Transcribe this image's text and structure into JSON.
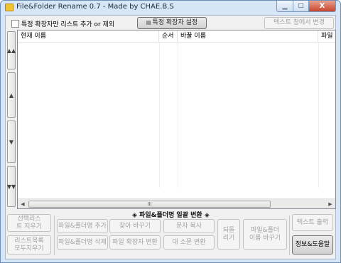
{
  "window": {
    "title": "File&Folder Rename 0.7 - Made by CHAE.B.S",
    "close_glyph": "X"
  },
  "toolbar": {
    "ext_only_label": "특정 확장자만 리스트 추가 or 제외",
    "ext_setting_label": "특정 확장자 설정",
    "text_change_label": "텍스트 창에서 변경"
  },
  "grid": {
    "columns": [
      "현재 이름",
      "순서",
      "바꿀 이름",
      "파일"
    ],
    "scroll_thumb": "III"
  },
  "side_arrows": {
    "top_all": "▲▲",
    "up": "▲",
    "down": "▼",
    "bottom_all": "▼▼"
  },
  "bottom": {
    "group_label": "◈ 파일&폴더명 일괄 변환 ◈",
    "clear_selected": "선택리스트 지우기",
    "clear_all": "리스트목록 모두지우기",
    "add_name": "파일&폴더명 추가",
    "delete_name": "파일&폴더명 삭제",
    "find_replace": "찾아 바꾸기",
    "ext_convert": "파일 확장자 변환",
    "copy_char": "문자 복사",
    "case_convert": "대 소문 변환",
    "revert": "되돌리기",
    "rename": "파일&폴더 이름 바꾸기",
    "text_output": "텍스트 출력",
    "info_help": "정보&도움말"
  }
}
